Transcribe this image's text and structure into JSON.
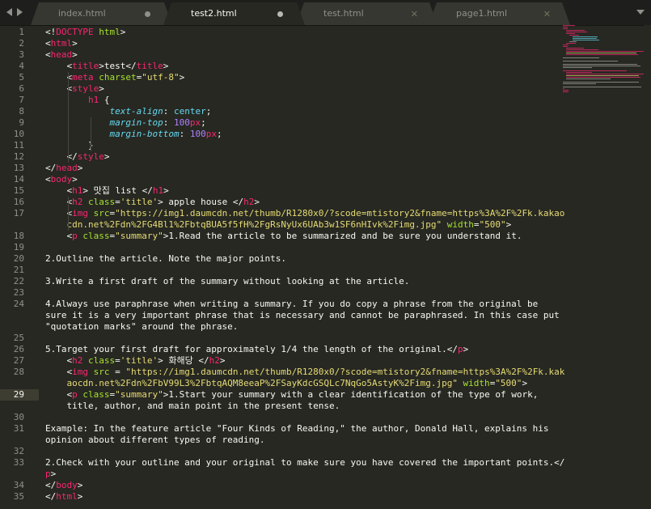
{
  "tabs": [
    {
      "label": "index.html",
      "state": "modified"
    },
    {
      "label": "test2.html",
      "state": "modified-active"
    },
    {
      "label": "test.html",
      "state": "close"
    },
    {
      "label": "page1.html",
      "state": "close"
    }
  ],
  "editor": {
    "current_line": 29,
    "lines": [
      {
        "n": "1",
        "segs": [
          [
            "<!",
            "t-punc"
          ],
          [
            "DOCTYPE",
            "t-doctype"
          ],
          [
            " html",
            "t-attr"
          ],
          [
            ">",
            "t-punc"
          ]
        ]
      },
      {
        "n": "2",
        "segs": [
          [
            "<",
            "t-punc"
          ],
          [
            "html",
            "t-tag"
          ],
          [
            ">",
            "t-punc"
          ]
        ]
      },
      {
        "n": "3",
        "segs": [
          [
            "<",
            "t-punc"
          ],
          [
            "head",
            "t-tag"
          ],
          [
            ">",
            "t-punc"
          ]
        ]
      },
      {
        "n": "4",
        "segs": [
          [
            "    <",
            "t-punc"
          ],
          [
            "title",
            "t-tag"
          ],
          [
            ">test</",
            "t-punc"
          ],
          [
            "title",
            "t-tag"
          ],
          [
            ">",
            "t-punc"
          ]
        ]
      },
      {
        "n": "5",
        "segs": [
          [
            "    <",
            "t-punc"
          ],
          [
            "meta",
            "t-tag"
          ],
          [
            " charset",
            "t-attr"
          ],
          [
            "=",
            "t-punc"
          ],
          [
            "\"utf-8\"",
            "t-str"
          ],
          [
            ">",
            "t-punc"
          ]
        ]
      },
      {
        "n": "6",
        "segs": [
          [
            "    <",
            "t-punc"
          ],
          [
            "style",
            "t-tag"
          ],
          [
            ">",
            "t-punc"
          ]
        ]
      },
      {
        "n": "7",
        "segs": [
          [
            "        ",
            "t-punc"
          ],
          [
            "h1",
            "t-tag"
          ],
          [
            " {",
            "t-punc"
          ]
        ]
      },
      {
        "n": "8",
        "segs": [
          [
            "            ",
            "t-punc"
          ],
          [
            "text-align",
            "t-prop"
          ],
          [
            ": ",
            "t-punc"
          ],
          [
            "center",
            "t-val"
          ],
          [
            ";",
            "t-punc"
          ]
        ]
      },
      {
        "n": "9",
        "segs": [
          [
            "            ",
            "t-punc"
          ],
          [
            "margin-top",
            "t-prop"
          ],
          [
            ": ",
            "t-punc"
          ],
          [
            "100",
            "t-num"
          ],
          [
            "px",
            "t-unit"
          ],
          [
            ";",
            "t-punc"
          ]
        ]
      },
      {
        "n": "10",
        "segs": [
          [
            "            ",
            "t-punc"
          ],
          [
            "margin-bottom",
            "t-prop"
          ],
          [
            ": ",
            "t-punc"
          ],
          [
            "100",
            "t-num"
          ],
          [
            "px",
            "t-unit"
          ],
          [
            ";",
            "t-punc"
          ]
        ]
      },
      {
        "n": "11",
        "segs": [
          [
            "        }",
            "t-punc"
          ]
        ]
      },
      {
        "n": "12",
        "segs": [
          [
            "    </",
            "t-punc"
          ],
          [
            "style",
            "t-tag"
          ],
          [
            ">",
            "t-punc"
          ]
        ]
      },
      {
        "n": "13",
        "segs": [
          [
            "</",
            "t-punc"
          ],
          [
            "head",
            "t-tag"
          ],
          [
            ">",
            "t-punc"
          ]
        ]
      },
      {
        "n": "14",
        "segs": [
          [
            "<",
            "t-punc"
          ],
          [
            "body",
            "t-tag"
          ],
          [
            ">",
            "t-punc"
          ]
        ]
      },
      {
        "n": "15",
        "segs": [
          [
            "    <",
            "t-punc"
          ],
          [
            "h1",
            "t-tag"
          ],
          [
            "> 맛집 list </",
            "t-punc"
          ],
          [
            "h1",
            "t-tag"
          ],
          [
            ">",
            "t-punc"
          ]
        ]
      },
      {
        "n": "16",
        "segs": [
          [
            "    <",
            "t-punc"
          ],
          [
            "h2",
            "t-tag"
          ],
          [
            " class",
            "t-attr"
          ],
          [
            "=",
            "t-punc"
          ],
          [
            "'title'",
            "t-str"
          ],
          [
            "> apple house </",
            "t-punc"
          ],
          [
            "h2",
            "t-tag"
          ],
          [
            ">",
            "t-punc"
          ]
        ]
      },
      {
        "n": "17",
        "segs": [
          [
            "    <",
            "t-punc"
          ],
          [
            "img",
            "t-tag"
          ],
          [
            " src",
            "t-attr"
          ],
          [
            "=",
            "t-punc"
          ],
          [
            "\"https://img1.daumcdn.net/thumb/R1280x0/?scode=mtistory2&fname=https%3A%2F%2Fk.kakao",
            "t-str"
          ]
        ]
      },
      {
        "n": "",
        "segs": [
          [
            "    cdn.net%2Fdn%2FG4Bl1%2FbtqBUA5f5fH%2FgRsNyUx6UAb3w1SF6nHIvk%2Fimg.jpg\"",
            "t-str"
          ],
          [
            " width",
            "t-attr"
          ],
          [
            "=",
            "t-punc"
          ],
          [
            "\"500\"",
            "t-str"
          ],
          [
            ">",
            "t-punc"
          ]
        ]
      },
      {
        "n": "18",
        "segs": [
          [
            "    <",
            "t-punc"
          ],
          [
            "p",
            "t-tag"
          ],
          [
            " class",
            "t-attr"
          ],
          [
            "=",
            "t-punc"
          ],
          [
            "\"summary\"",
            "t-str"
          ],
          [
            ">1.Read the article to be summarized and be sure you understand it.",
            "t-punc"
          ]
        ]
      },
      {
        "n": "19",
        "segs": []
      },
      {
        "n": "20",
        "segs": [
          [
            "2.Outline the article. Note the major points.",
            "t-punc"
          ]
        ]
      },
      {
        "n": "21",
        "segs": []
      },
      {
        "n": "22",
        "segs": [
          [
            "3.Write a first draft of the summary without looking at the article.",
            "t-punc"
          ]
        ]
      },
      {
        "n": "23",
        "segs": []
      },
      {
        "n": "24",
        "segs": [
          [
            "4.Always use paraphrase when writing a summary. If you do copy a phrase from the original be",
            "t-punc"
          ]
        ]
      },
      {
        "n": "",
        "segs": [
          [
            "sure it is a very important phrase that is necessary and cannot be paraphrased. In this case put",
            "t-punc"
          ]
        ]
      },
      {
        "n": "",
        "segs": [
          [
            "\"quotation marks\" around the phrase.",
            "t-punc"
          ]
        ]
      },
      {
        "n": "25",
        "segs": []
      },
      {
        "n": "26",
        "segs": [
          [
            "5.Target your first draft for approximately 1/4 the length of the original.</",
            "t-punc"
          ],
          [
            "p",
            "t-tag"
          ],
          [
            ">",
            "t-punc"
          ]
        ]
      },
      {
        "n": "27",
        "segs": [
          [
            "    <",
            "t-punc"
          ],
          [
            "h2",
            "t-tag"
          ],
          [
            " class",
            "t-attr"
          ],
          [
            "=",
            "t-punc"
          ],
          [
            "'title'",
            "t-str"
          ],
          [
            "> 화해당 </",
            "t-punc"
          ],
          [
            "h2",
            "t-tag"
          ],
          [
            ">",
            "t-punc"
          ]
        ]
      },
      {
        "n": "28",
        "segs": [
          [
            "    <",
            "t-punc"
          ],
          [
            "img",
            "t-tag"
          ],
          [
            " src",
            "t-attr"
          ],
          [
            " = ",
            "t-punc"
          ],
          [
            "\"https://img1.daumcdn.net/thumb/R1280x0/?scode=mtistory2&fname=https%3A%2F%2Fk.kak",
            "t-str"
          ]
        ]
      },
      {
        "n": "",
        "segs": [
          [
            "    aocdn.net%2Fdn%2FbV99L3%2FbtqAQM8eeaP%2FSayKdcGSQLc7NqGo5AstyK%2Fimg.jpg\"",
            "t-str"
          ],
          [
            " width",
            "t-attr"
          ],
          [
            "=",
            "t-punc"
          ],
          [
            "\"500\"",
            "t-str"
          ],
          [
            ">",
            "t-punc"
          ]
        ]
      },
      {
        "n": "29",
        "segs": [
          [
            "    <",
            "t-punc"
          ],
          [
            "p",
            "t-tag"
          ],
          [
            " class",
            "t-attr"
          ],
          [
            "=",
            "t-punc"
          ],
          [
            "\"summary\"",
            "t-str"
          ],
          [
            ">1.Start your summary with a clear identification of the type of work,",
            "t-punc"
          ]
        ]
      },
      {
        "n": "",
        "segs": [
          [
            "    title, author, and main point in the present tense.",
            "t-punc"
          ]
        ]
      },
      {
        "n": "30",
        "segs": []
      },
      {
        "n": "31",
        "segs": [
          [
            "Example: In the feature article \"Four Kinds of Reading,\" the author, Donald Hall, explains his",
            "t-punc"
          ]
        ]
      },
      {
        "n": "",
        "segs": [
          [
            "opinion about different types of reading.",
            "t-punc"
          ]
        ]
      },
      {
        "n": "32",
        "segs": []
      },
      {
        "n": "33",
        "segs": [
          [
            "2.Check with your outline and your original to make sure you have covered the important points.</",
            "t-punc"
          ]
        ]
      },
      {
        "n": "",
        "segs": [
          [
            "p",
            "t-tag"
          ],
          [
            ">",
            "t-punc"
          ]
        ]
      },
      {
        "n": "34",
        "segs": [
          [
            "</",
            "t-punc"
          ],
          [
            "body",
            "t-tag"
          ],
          [
            ">",
            "t-punc"
          ]
        ]
      },
      {
        "n": "35",
        "segs": [
          [
            "</",
            "t-punc"
          ],
          [
            "html",
            "t-tag"
          ],
          [
            ">",
            "t-punc"
          ]
        ]
      }
    ]
  }
}
